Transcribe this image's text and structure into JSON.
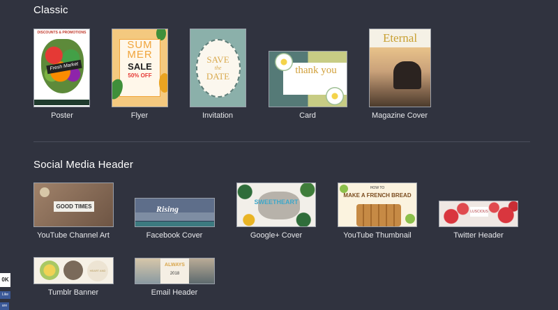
{
  "sections": {
    "classic": {
      "title": "Classic",
      "tiles": [
        {
          "label": "Poster",
          "art": {
            "top": "DISCOUNTS & PROMOTIONS",
            "ribbon": "Fresh Market"
          }
        },
        {
          "label": "Flyer",
          "art": {
            "line1": "SUM",
            "line2": "MER",
            "sale": "SALE",
            "off": "50% OFF"
          }
        },
        {
          "label": "Invitation",
          "art": {
            "l1": "SAVE",
            "l2": "the",
            "l3": "DATE"
          }
        },
        {
          "label": "Card",
          "art": {
            "text": "thank you"
          }
        },
        {
          "label": "Magazine Cover",
          "art": {
            "title": "Eternal"
          }
        }
      ]
    },
    "social": {
      "title": "Social Media Header",
      "tiles": [
        {
          "label": "YouTube Channel Art",
          "art": {
            "text": "GOOD TIMES"
          }
        },
        {
          "label": "Facebook Cover",
          "art": {
            "text": "Rising"
          }
        },
        {
          "label": "Google+ Cover",
          "art": {
            "text": "SWEETHEART"
          }
        },
        {
          "label": "YouTube Thumbnail",
          "art": {
            "small": "HOW TO",
            "text": "MAKE A FRENCH BREAD"
          }
        },
        {
          "label": "Twitter Header",
          "art": {
            "text": "LUSCIOUS"
          }
        },
        {
          "label": "Tumblr Banner",
          "art": {
            "text": "HEART AND SOUL"
          }
        },
        {
          "label": "Email Header",
          "art": {
            "text": "ALWAYS",
            "date": "2018"
          }
        }
      ]
    }
  },
  "side_widgets": {
    "ok": "0K",
    "like": "Like",
    "share": "are"
  },
  "colors": {
    "background": "#30333f",
    "divider": "#4a4e5b",
    "label": "#e8e9ec"
  }
}
